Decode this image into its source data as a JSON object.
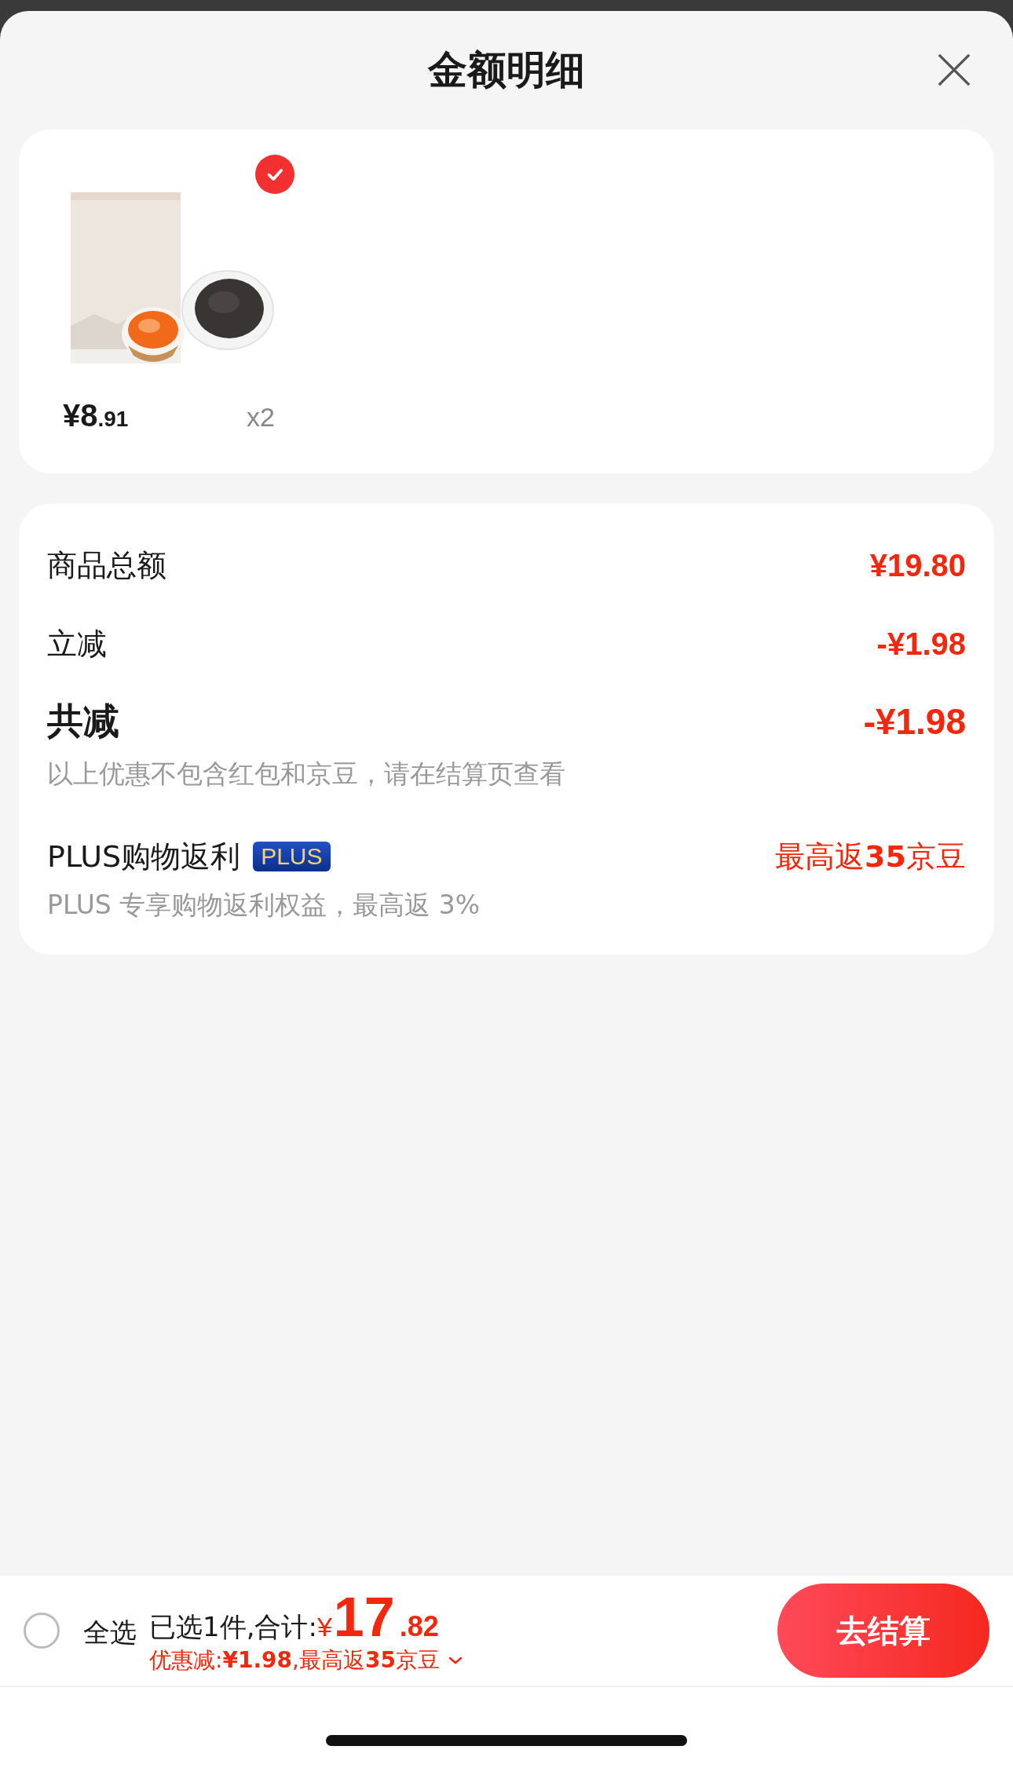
{
  "header": {
    "title": "金额明细"
  },
  "product": {
    "selected": true,
    "price_main": "¥8",
    "price_decimal": ".91",
    "quantity": "x2"
  },
  "summary": [
    {
      "kind": "normal",
      "label": "商品总额",
      "value": "¥19.80"
    },
    {
      "kind": "normal",
      "label": "立减",
      "value": "-¥1.98"
    },
    {
      "kind": "total",
      "label": "共减",
      "value": "-¥1.98",
      "note": "以上优惠不包含红包和京豆，请在结算页查看"
    },
    {
      "kind": "plus",
      "label": "PLUS购物返利",
      "badge": "PLUS",
      "value": "最高返**35**京豆",
      "note": "PLUS 专享购物返利权益，最高返 3%"
    }
  ],
  "footer": {
    "select_all": {
      "label": "全选",
      "checked": false
    },
    "selected_text": "已选1件,合计:",
    "currency": "¥",
    "total_integer": "17",
    "total_decimal": ".82",
    "savings": "优惠减:**¥1.98**,最高返**35**京豆",
    "checkout": "去结算"
  }
}
